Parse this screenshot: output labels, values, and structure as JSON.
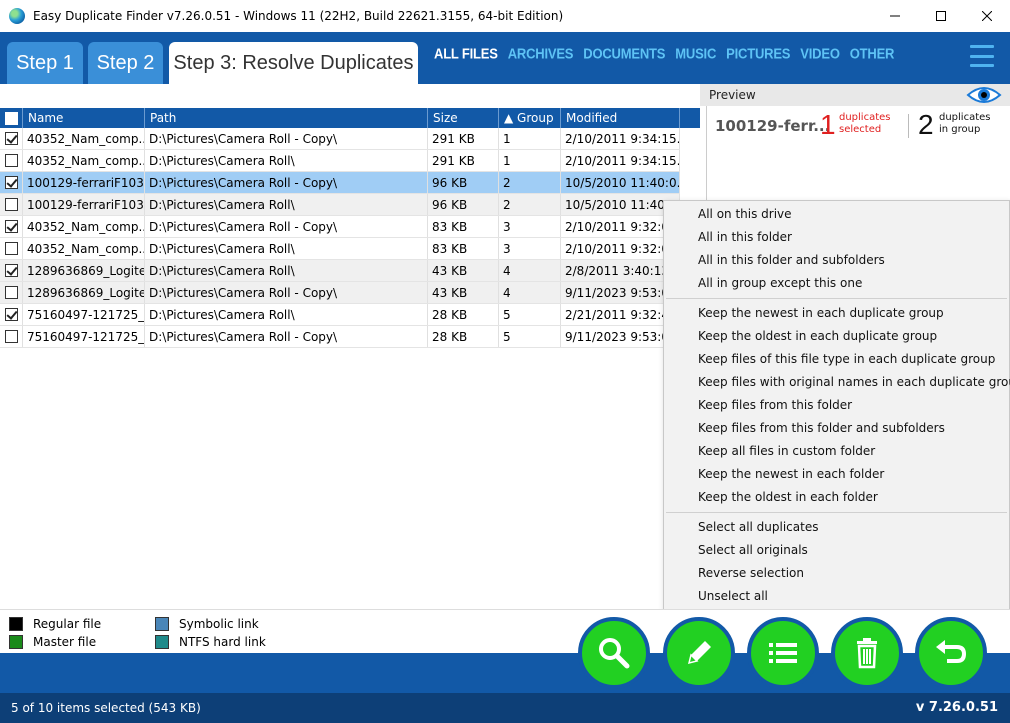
{
  "window": {
    "title": "Easy Duplicate Finder v7.26.0.51 - Windows 11 (22H2, Build 22621.3155, 64-bit Edition)"
  },
  "steps": [
    {
      "label": "Step 1"
    },
    {
      "label": "Step 2"
    },
    {
      "label": "Step 3: Resolve Duplicates"
    }
  ],
  "categories": [
    "ALL FILES",
    "ARCHIVES",
    "DOCUMENTS",
    "MUSIC",
    "PICTURES",
    "VIDEO",
    "OTHER"
  ],
  "table": {
    "headers": {
      "name": "Name",
      "path": "Path",
      "size": "Size",
      "group": "▲ Group",
      "modified": "Modified"
    },
    "rows": [
      {
        "checked": true,
        "name": "40352_Nam_comp...",
        "path": "D:\\Pictures\\Camera Roll - Copy\\",
        "size": "291 KB",
        "group": "1",
        "modified": "2/10/2011 9:34:15..."
      },
      {
        "checked": false,
        "name": "40352_Nam_comp...",
        "path": "D:\\Pictures\\Camera Roll\\",
        "size": "291 KB",
        "group": "1",
        "modified": "2/10/2011 9:34:15..."
      },
      {
        "checked": true,
        "name": "100129-ferrariF103...",
        "path": "D:\\Pictures\\Camera Roll - Copy\\",
        "size": "96 KB",
        "group": "2",
        "modified": "10/5/2010 11:40:0..."
      },
      {
        "checked": false,
        "name": "100129-ferrariF103...",
        "path": "D:\\Pictures\\Camera Roll\\",
        "size": "96 KB",
        "group": "2",
        "modified": "10/5/2010 11:40:0..."
      },
      {
        "checked": true,
        "name": "40352_Nam_comp...",
        "path": "D:\\Pictures\\Camera Roll - Copy\\",
        "size": "83 KB",
        "group": "3",
        "modified": "2/10/2011 9:32:08..."
      },
      {
        "checked": false,
        "name": "40352_Nam_comp...",
        "path": "D:\\Pictures\\Camera Roll\\",
        "size": "83 KB",
        "group": "3",
        "modified": "2/10/2011 9:32:08..."
      },
      {
        "checked": true,
        "name": "1289636869_Logite...",
        "path": "D:\\Pictures\\Camera Roll\\",
        "size": "43 KB",
        "group": "4",
        "modified": "2/8/2011 3:40:13..."
      },
      {
        "checked": false,
        "name": "1289636869_Logite...",
        "path": "D:\\Pictures\\Camera Roll - Copy\\",
        "size": "43 KB",
        "group": "4",
        "modified": "9/11/2023 9:53:06..."
      },
      {
        "checked": true,
        "name": "75160497-121725_...",
        "path": "D:\\Pictures\\Camera Roll\\",
        "size": "28 KB",
        "group": "5",
        "modified": "2/21/2011 9:32:40..."
      },
      {
        "checked": false,
        "name": "75160497-121725_...",
        "path": "D:\\Pictures\\Camera Roll - Copy\\",
        "size": "28 KB",
        "group": "5",
        "modified": "9/11/2023 9:53:06..."
      }
    ]
  },
  "preview": {
    "label": "Preview",
    "filename": "100129-ferr...",
    "dup_selected_count": "1",
    "dup_selected_label_1": "duplicates",
    "dup_selected_label_2": "selected",
    "dup_group_count": "2",
    "dup_group_label_1": "duplicates",
    "dup_group_label_2": "in group"
  },
  "context_menu": {
    "group1": [
      "All on this drive",
      "All in this folder",
      "All in this folder and subfolders",
      "All in group except this one"
    ],
    "group2": [
      "Keep the newest in each duplicate group",
      "Keep the oldest in each duplicate group",
      "Keep files of this file type in each duplicate group",
      "Keep files with original names in each duplicate group",
      "Keep files from this folder",
      "Keep files from this folder and subfolders",
      "Keep all files in custom folder",
      "Keep the newest in each folder",
      "Keep the oldest in each folder"
    ],
    "group3": [
      "Select all duplicates",
      "Select all originals",
      "Reverse selection",
      "Unselect all"
    ]
  },
  "legend": {
    "regular": "Regular file",
    "master": "Master file",
    "symlink": "Symbolic link",
    "hardlink": "NTFS hard link",
    "colors": {
      "regular": "#000000",
      "master": "#1a8a1a",
      "symlink": "#4a86b8",
      "hardlink": "#1f8a8a"
    }
  },
  "status": {
    "selection": "5 of 10 items selected (543 KB)",
    "version": "v 7.26.0.51"
  },
  "colors": {
    "brand_blue": "#1259a7",
    "action_green": "#22d022",
    "status_navy": "#0d3f77"
  }
}
